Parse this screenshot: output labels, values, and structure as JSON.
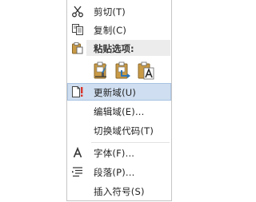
{
  "menu": {
    "cut_label": "剪切(T)",
    "copy_label": "复制(C)",
    "paste_options_label": "粘贴选项:",
    "paste_options": [
      {
        "icon": "paste-keep-source-formatting-icon"
      },
      {
        "icon": "paste-merge-formatting-icon"
      },
      {
        "icon": "paste-text-only-icon"
      }
    ],
    "update_field_label": "更新域(U)",
    "edit_field_label": "编辑域(E)...",
    "toggle_field_codes_label": "切换域代码(T)",
    "font_label": "字体(F)...",
    "paragraph_label": "段落(P)...",
    "insert_symbol_label": "插入符号(S)"
  },
  "colors": {
    "highlight": "#cfdef0",
    "highlight_border": "#a9c3e2",
    "clipboard_tan": "#c99a45",
    "accent_blue": "#2e75b6",
    "alert_red": "#d9342b"
  }
}
